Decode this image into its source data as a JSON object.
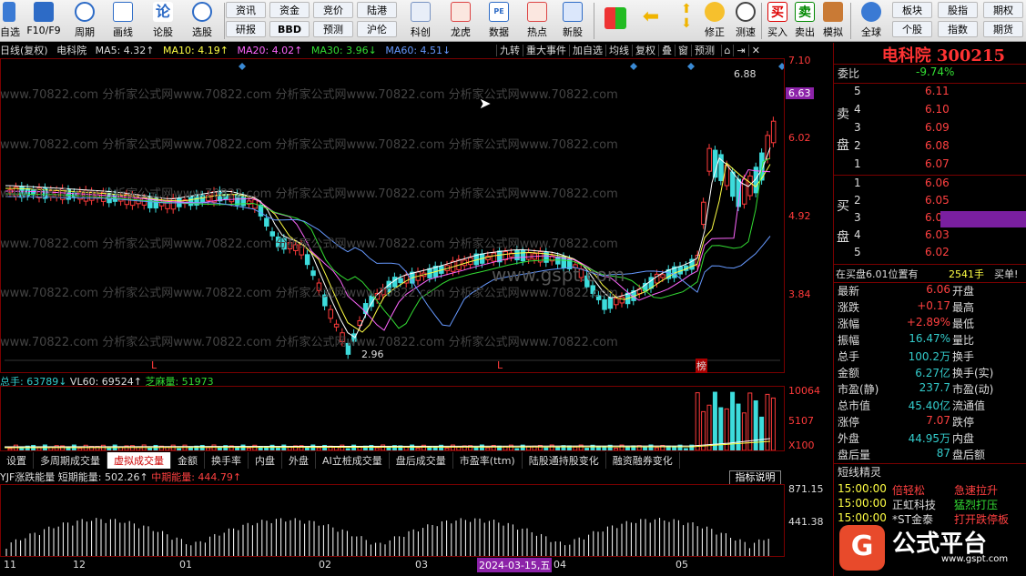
{
  "toolbar": {
    "buttons": [
      {
        "label": "自选",
        "icon": "list-icon"
      },
      {
        "label": "F10/F9",
        "icon": "document-icon"
      },
      {
        "label": "周期",
        "icon": "clock-icon"
      },
      {
        "label": "画线",
        "icon": "pencil-icon"
      },
      {
        "label": "论股",
        "icon": "discuss-icon"
      },
      {
        "label": "选股",
        "icon": "chart-select-icon"
      },
      {
        "label": "科创",
        "icon": "chart-icon"
      },
      {
        "label": "龙虎",
        "icon": "dragon-icon"
      },
      {
        "label": "数据",
        "icon": "pe-icon"
      },
      {
        "label": "热点",
        "icon": "hot-icon"
      },
      {
        "label": "新股",
        "icon": "new-stock-icon"
      },
      {
        "label": "修正",
        "icon": "power-icon"
      },
      {
        "label": "测速",
        "icon": "stopwatch-icon"
      },
      {
        "label": "买入",
        "icon": "buy-icon"
      },
      {
        "label": "卖出",
        "icon": "sell-icon"
      },
      {
        "label": "模拟",
        "icon": "hammer-icon"
      },
      {
        "label": "全球",
        "icon": "globe-icon"
      }
    ],
    "small_buttons": [
      "资讯",
      "资金",
      "竞价",
      "陆港",
      "研报",
      "BBD",
      "预测",
      "沪伦"
    ],
    "right_buttons": [
      "板块",
      "股指",
      "期权",
      "个股",
      "指数",
      "期货"
    ]
  },
  "chart": {
    "header": {
      "period": "日线(复权)",
      "name": "电科院",
      "ma5": "MA5: 4.32↑",
      "ma10": "MA10: 4.19↑",
      "ma20": "MA20: 4.02↑",
      "ma30": "MA30: 3.96↓",
      "ma60": "MA60: 4.51↓"
    },
    "topmenu": [
      "九转",
      "重大事件",
      "加自选",
      "均线",
      "复权",
      "叠",
      "窗",
      "预测"
    ],
    "price_labels": [
      "7.10",
      "6.63",
      "6.02",
      "4.92",
      "3.84"
    ],
    "high_label": "6.88",
    "low_label": "2.96",
    "watermark": "www.70822.com 分析家公式网www.70822.com 分析家公式网www.70822.com 分析家公式网www.70822.com",
    "center_watermark": "www.gspt.com",
    "rank_label": "榜"
  },
  "volume": {
    "total": "总手: 63789↓",
    "vl60": "VL60: 69524↑",
    "zmm": "芝麻量: 51973",
    "labels": [
      "10064",
      "5107",
      "X100"
    ]
  },
  "indicator_tabs": [
    "设置",
    "多周期成交量",
    "虚拟成交量",
    "金额",
    "换手率",
    "内盘",
    "外盘",
    "AI立桩成交量",
    "盘后成交量",
    "市盈率(ttm)",
    "陆股通持股变化",
    "融资融券变化"
  ],
  "energy": {
    "name": "YJF涨跌能量",
    "short": "短期能量: 502.26↑",
    "mid": "中期能量: 444.79↑",
    "explain": "指标说明",
    "labels": [
      "871.15",
      "441.38"
    ]
  },
  "xaxis": {
    "labels": [
      "11",
      "12",
      "01",
      "02",
      "03",
      "04",
      "05"
    ],
    "date_tip": "2024-03-15,五"
  },
  "quote": {
    "title": "电科院 300215",
    "weibi_label": "委比",
    "weibi_value": "-9.74%",
    "sell_label": "卖盘",
    "buy_label": "买盘",
    "sells": [
      {
        "lvl": "5",
        "price": "6.11"
      },
      {
        "lvl": "4",
        "price": "6.10"
      },
      {
        "lvl": "3",
        "price": "6.09"
      },
      {
        "lvl": "2",
        "price": "6.08"
      },
      {
        "lvl": "1",
        "price": "6.07"
      }
    ],
    "buys": [
      {
        "lvl": "1",
        "price": "6.06"
      },
      {
        "lvl": "2",
        "price": "6.05"
      },
      {
        "lvl": "3",
        "price": "6.04"
      },
      {
        "lvl": "4",
        "price": "6.03"
      },
      {
        "lvl": "5",
        "price": "6.02"
      }
    ],
    "buy_info": {
      "text": "在买盘6.01位置有",
      "amount": "2541手",
      "tag": "买单!"
    },
    "stats": [
      {
        "l": "最新",
        "v": "6.06",
        "r": "开盘"
      },
      {
        "l": "涨跌",
        "v": "+0.17",
        "r": "最高"
      },
      {
        "l": "涨幅",
        "v": "+2.89%",
        "r": "最低"
      },
      {
        "l": "振幅",
        "v": "16.47%",
        "r": "量比"
      },
      {
        "l": "总手",
        "v": "100.2万",
        "r": "换手"
      },
      {
        "l": "金额",
        "v": "6.27亿",
        "r": "换手(实)"
      },
      {
        "l": "市盈(静)",
        "v": "237.7",
        "r": "市盈(动)"
      },
      {
        "l": "总市值",
        "v": "45.40亿",
        "r": "流通值"
      },
      {
        "l": "涨停",
        "v": "7.07",
        "r": "跌停"
      },
      {
        "l": "外盘",
        "v": "44.95万",
        "r": "内盘"
      },
      {
        "l": "盘后量",
        "v": "87",
        "r": "盘后额"
      }
    ],
    "news_title": "短线精灵",
    "news": [
      {
        "time": "15:00:00",
        "name": "倍轻松",
        "event": "急速拉升"
      },
      {
        "time": "15:00:00",
        "name": "正虹科技",
        "event": "猛烈打压"
      },
      {
        "time": "15:00:00",
        "name": "*ST金泰",
        "event": "打开跌停板"
      }
    ],
    "logo": "公式平台",
    "logo_url": "www.gspt.com"
  }
}
